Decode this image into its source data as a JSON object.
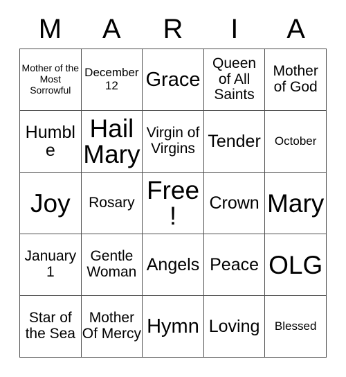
{
  "card": {
    "title_letters": [
      "M",
      "A",
      "R",
      "I",
      "A"
    ],
    "rows": [
      [
        {
          "text": "Mother of the Most Sorrowful",
          "size": "fs-xs"
        },
        {
          "text": "December 12",
          "size": "fs-s"
        },
        {
          "text": "Grace",
          "size": "fs-xl"
        },
        {
          "text": "Queen of All Saints",
          "size": "fs-m"
        },
        {
          "text": "Mother of God",
          "size": "fs-m"
        }
      ],
      [
        {
          "text": "Humble",
          "size": "fs-l"
        },
        {
          "text": "Hail Mary",
          "size": "fs-xxl"
        },
        {
          "text": "Virgin of Virgins",
          "size": "fs-m"
        },
        {
          "text": "Tender",
          "size": "fs-l"
        },
        {
          "text": "October",
          "size": "fs-s"
        }
      ],
      [
        {
          "text": "Joy",
          "size": "fs-xxl"
        },
        {
          "text": "Rosary",
          "size": "fs-m"
        },
        {
          "text": "Free!",
          "size": "fs-xxl"
        },
        {
          "text": "Crown",
          "size": "fs-l"
        },
        {
          "text": "Mary",
          "size": "fs-xxl"
        }
      ],
      [
        {
          "text": "January 1",
          "size": "fs-m"
        },
        {
          "text": "Gentle Woman",
          "size": "fs-m"
        },
        {
          "text": "Angels",
          "size": "fs-l"
        },
        {
          "text": "Peace",
          "size": "fs-l"
        },
        {
          "text": "OLG",
          "size": "fs-xxl"
        }
      ],
      [
        {
          "text": "Star of the Sea",
          "size": "fs-m"
        },
        {
          "text": "Mother Of Mercy",
          "size": "fs-m"
        },
        {
          "text": "Hymn",
          "size": "fs-xl"
        },
        {
          "text": "Loving",
          "size": "fs-l"
        },
        {
          "text": "Blessed",
          "size": "fs-s"
        }
      ]
    ],
    "free_space_label": "Free!",
    "colors": {
      "background": "#ffffff",
      "text": "#000000",
      "grid_line": "#4d4d4d"
    }
  }
}
